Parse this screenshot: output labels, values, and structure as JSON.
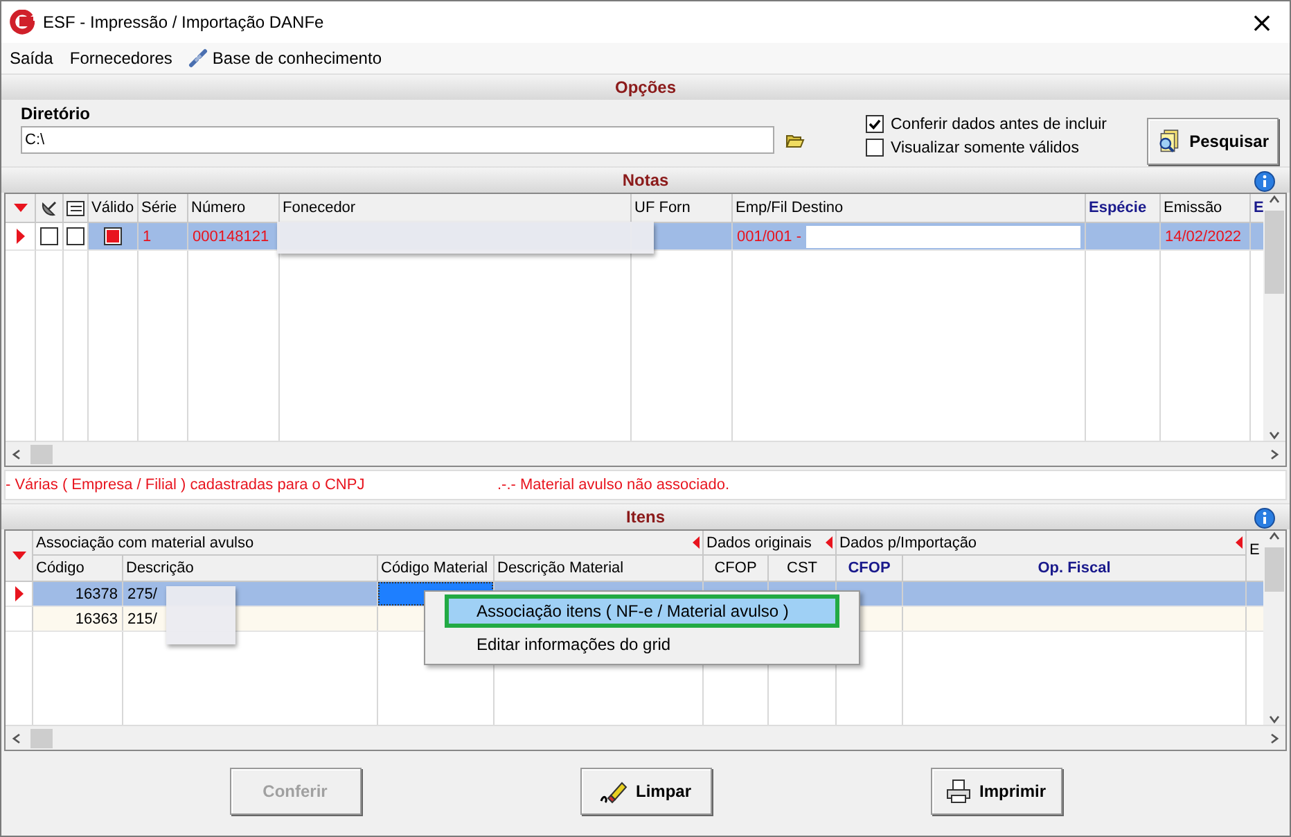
{
  "window": {
    "title": "ESF - Impressão / Importação DANFe",
    "close": "×"
  },
  "menu": [
    {
      "label": "Saída",
      "kind": "text"
    },
    {
      "label": "Fornecedores",
      "kind": "text"
    },
    {
      "label": "Base de conhecimento",
      "kind": "link"
    }
  ],
  "options": {
    "title": "Opções",
    "directory_label": "Diretório",
    "directory_value": "C:\\",
    "checkboxes": [
      {
        "label": "Conferir dados antes de incluir",
        "checked": true
      },
      {
        "label": "Visualizar somente válidos",
        "checked": false
      }
    ],
    "search_button": "Pesquisar"
  },
  "notas": {
    "title": "Notas",
    "columns": [
      {
        "label": "Válido",
        "highlighted": false
      },
      {
        "label": "Série",
        "highlighted": false
      },
      {
        "label": "Número",
        "highlighted": false
      },
      {
        "label": "Fonecedor",
        "highlighted": false
      },
      {
        "label": "UF Forn",
        "highlighted": false
      },
      {
        "label": "Emp/Fil Destino",
        "highlighted": false
      },
      {
        "label": "Espécie",
        "highlighted": true
      },
      {
        "label": "Emissão",
        "highlighted": false
      },
      {
        "label": "E",
        "highlighted": true
      }
    ],
    "rows": [
      {
        "selected": true,
        "flag_1": false,
        "flag_2": false,
        "valid": true,
        "serie": "1",
        "numero": "000148121",
        "destino": "001/001 -",
        "emissao": "14/02/2022"
      }
    ]
  },
  "messages": [
    "- Várias ( Empresa / Filial ) cadastradas para o CNPJ",
    ".-.- Material avulso não associado."
  ],
  "itens": {
    "title": "Itens",
    "groups": [
      "Associação com material avulso",
      "Dados originais",
      "Dados p/Importação"
    ],
    "columns": [
      {
        "label": "Código",
        "highlighted": false
      },
      {
        "label": "Descrição",
        "highlighted": false
      },
      {
        "label": "Código Material",
        "highlighted": false
      },
      {
        "label": "Descrição Material",
        "highlighted": false
      },
      {
        "label": "CFOP",
        "highlighted": false
      },
      {
        "label": "CST",
        "highlighted": false
      },
      {
        "label": "CFOP",
        "highlighted": true
      },
      {
        "label": "Op. Fiscal",
        "highlighted": true
      }
    ],
    "extra_column": "E",
    "rows": [
      {
        "selected": true,
        "codigo": "16378",
        "descricao": "275/",
        "material_focused": true
      },
      {
        "selected": false,
        "codigo": "16363",
        "descricao": "215/",
        "material_focused": false
      }
    ]
  },
  "context_menu": [
    {
      "label": "Associação itens ( NF-e / Material avulso )",
      "selected": true
    },
    {
      "label": "Editar informações do grid",
      "selected": false
    }
  ],
  "buttons": [
    {
      "label": "Conferir",
      "disabled": true,
      "kind": "check"
    },
    {
      "label": "Limpar",
      "disabled": false,
      "kind": "eraser"
    },
    {
      "label": "Imprimir",
      "disabled": false,
      "kind": "printer"
    }
  ]
}
